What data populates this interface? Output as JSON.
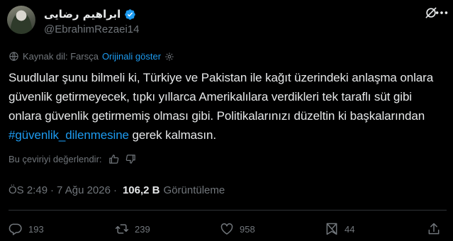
{
  "author": {
    "display_name": "ابراهیم رضایی",
    "handle": "@EbrahimRezaei14"
  },
  "translation": {
    "source_label": "Kaynak dil: Farsça",
    "show_original_label": "Orijinali göster"
  },
  "tweet": {
    "text_before": "Suudlular şunu bilmeli ki, Türkiye ve Pakistan ile kağıt üzerindeki anlaşma onlara güvenlik getirmeyecek, tıpkı yıllarca Amerikalılara verdikleri tek taraflı süt gibi onlara güvenlik getirmemiş olması gibi. Politikalarınızı düzeltin ki başkalarından ",
    "hashtag": "#güvenlik_dilenmesine",
    "text_after": " gerek kalmasın."
  },
  "rate_translation_label": "Bu çeviriyi değerlendir:",
  "meta": {
    "time": "ÖS 2:49",
    "separator": "·",
    "date": "7 Ağu 2026",
    "views_count": "106,2 B",
    "views_label": "Görüntüleme"
  },
  "actions": {
    "replies": "193",
    "reposts": "239",
    "likes": "958",
    "bookmarks": "44"
  },
  "icons": {
    "verified": "verified-badge-icon",
    "grok": "grok-icon",
    "more": "more-icon",
    "translate": "globe-icon",
    "settings": "gear-icon",
    "thumbs_up": "thumbs-up-icon",
    "thumbs_down": "thumbs-down-icon",
    "reply": "reply-icon",
    "repost": "repost-icon",
    "like": "heart-icon",
    "bookmark": "bookmark-icon",
    "share": "share-icon"
  },
  "colors": {
    "background": "#000000",
    "text": "#e7e9ea",
    "secondary": "#71767b",
    "accent": "#1d9bf0"
  }
}
